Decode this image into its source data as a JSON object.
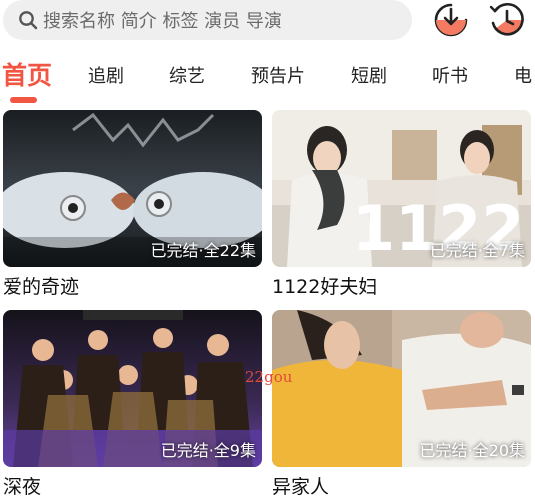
{
  "search": {
    "placeholder": "搜索名称 简介 标签 演员 导演",
    "icon": "search-icon"
  },
  "header": {
    "download_icon": "download-icon",
    "history_icon": "history-icon"
  },
  "tabs": [
    {
      "label": "首页",
      "active": true
    },
    {
      "label": "追剧",
      "active": false
    },
    {
      "label": "综艺",
      "active": false
    },
    {
      "label": "预告片",
      "active": false
    },
    {
      "label": "短剧",
      "active": false
    },
    {
      "label": "听书",
      "active": false
    },
    {
      "label": "电",
      "active": false
    }
  ],
  "colors": {
    "accent": "#f15642",
    "search_bg": "#efefef"
  },
  "cards": [
    {
      "title": "爱的奇迹",
      "status": "已完结·全22集"
    },
    {
      "title": "1122好夫妇",
      "status": "已完结·全7集",
      "poster_text": "1122"
    },
    {
      "title": "深夜",
      "status": "已完结·全9集"
    },
    {
      "title": "异家人",
      "status": "已完结·全20集"
    }
  ],
  "watermark": "22gou"
}
